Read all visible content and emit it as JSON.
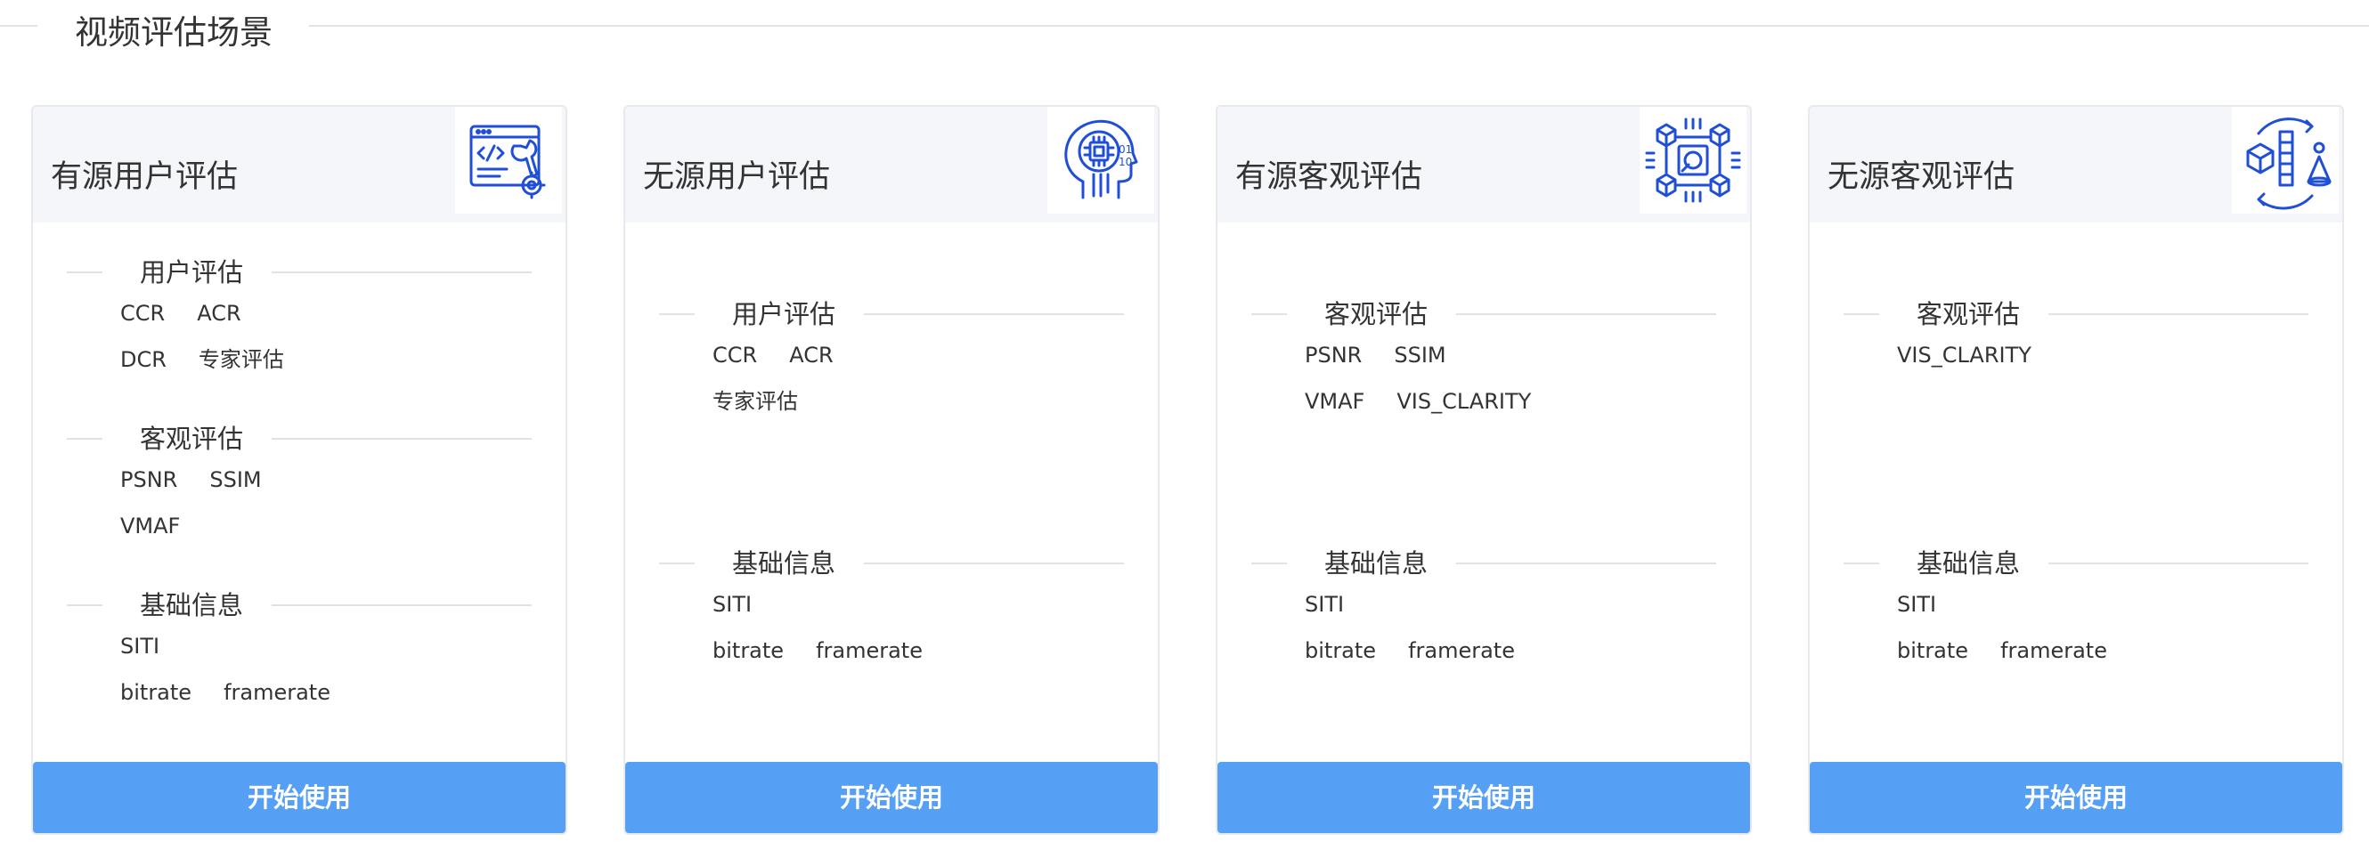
{
  "page": {
    "title": "视频评估场景"
  },
  "cards": [
    {
      "title": "有源用户评估",
      "icon": "code-tools-icon",
      "sections": [
        {
          "label": "用户评估",
          "items": [
            "CCR",
            "ACR",
            "DCR",
            "专家评估"
          ]
        },
        {
          "label": "客观评估",
          "items": [
            "PSNR",
            "SSIM",
            "VMAF"
          ]
        },
        {
          "label": "基础信息",
          "items": [
            "SITI",
            "bitrate",
            "framerate"
          ]
        }
      ],
      "button": "开始使用"
    },
    {
      "title": "无源用户评估",
      "icon": "ai-head-icon",
      "sections": [
        {
          "label": "用户评估",
          "items": [
            "CCR",
            "ACR",
            "专家评估"
          ]
        },
        {
          "label": "基础信息",
          "items": [
            "SITI",
            "bitrate",
            "framerate"
          ]
        }
      ],
      "button": "开始使用"
    },
    {
      "title": "有源客观评估",
      "icon": "cubes-network-icon",
      "sections": [
        {
          "label": "客观评估",
          "items": [
            "PSNR",
            "SSIM",
            "VMAF",
            "VIS_CLARITY"
          ]
        },
        {
          "label": "基础信息",
          "items": [
            "SITI",
            "bitrate",
            "framerate"
          ]
        }
      ],
      "button": "开始使用"
    },
    {
      "title": "无源客观评估",
      "icon": "3d-shapes-icon",
      "sections": [
        {
          "label": "客观评估",
          "items": [
            "VIS_CLARITY"
          ]
        },
        {
          "label": "基础信息",
          "items": [
            "SITI",
            "bitrate",
            "framerate"
          ]
        }
      ],
      "button": "开始使用"
    }
  ],
  "colors": {
    "accent": "#559ff5",
    "icon": "#1f4fd6",
    "header_bg": "#f4f6fa"
  }
}
